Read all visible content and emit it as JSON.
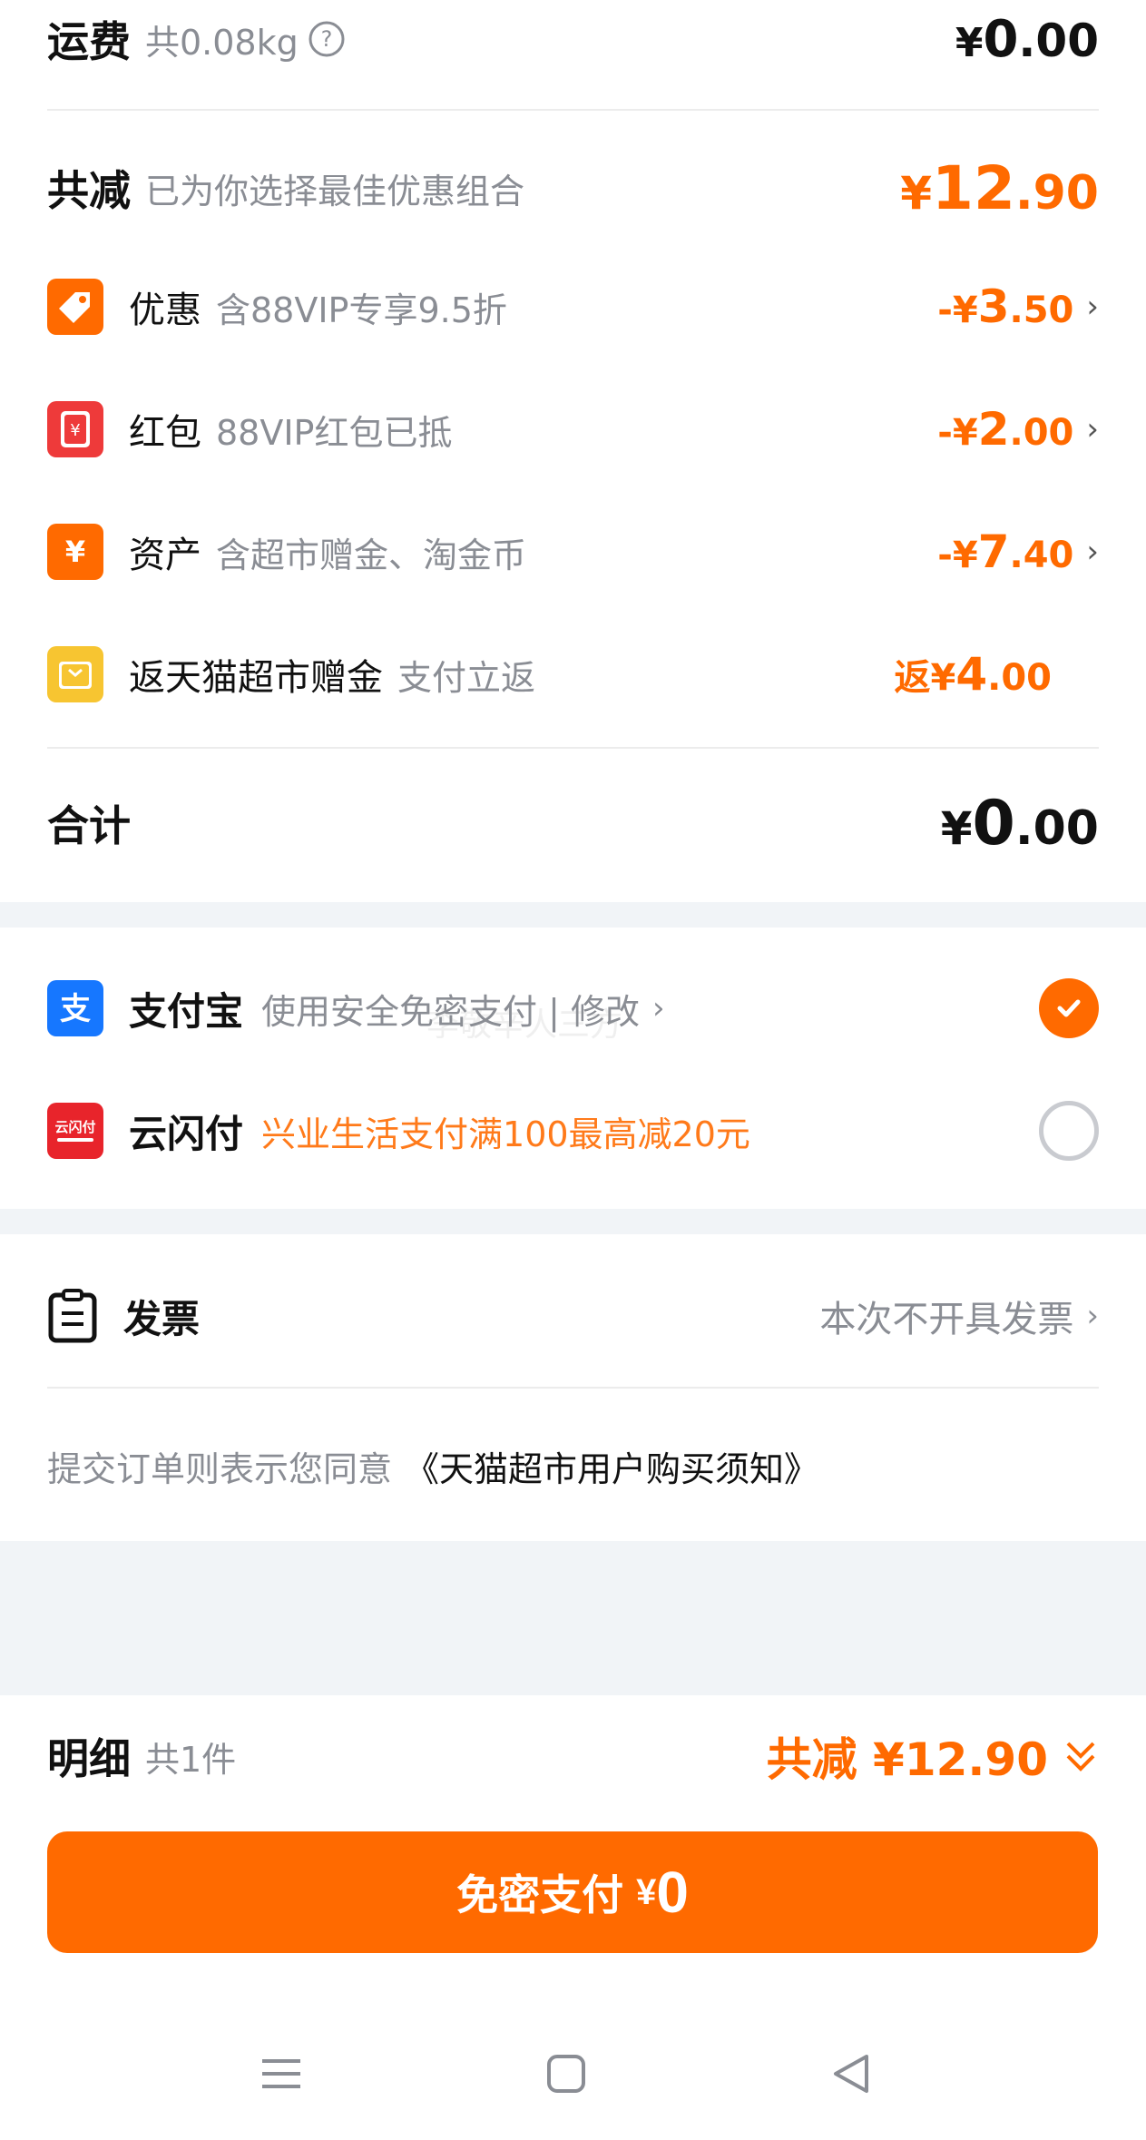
{
  "shipping": {
    "label": "运费",
    "weight": "共0.08kg",
    "help_icon": "question-circle-icon",
    "price_symbol": "¥",
    "price_int": "0",
    "price_dec": ".00"
  },
  "discount_total": {
    "label": "共减",
    "subtitle": "已为你选择最佳优惠组合",
    "price_symbol": "¥",
    "price_int": "12",
    "price_dec": ".90"
  },
  "discount_items": [
    {
      "icon": "tag-icon",
      "label": "优惠",
      "sub": "含88VIP专享9.5折",
      "prefix": "-¥",
      "int": "3",
      "dec": ".50",
      "color": "#ff6a00"
    },
    {
      "icon": "red-envelope-icon",
      "label": "红包",
      "sub": "88VIP红包已抵",
      "prefix": "-¥",
      "int": "2",
      "dec": ".00",
      "color": "#ee3a3a"
    },
    {
      "icon": "yuan-coin-icon",
      "label": "资产",
      "sub": "含超市赠金、淘金币",
      "prefix": "-¥",
      "int": "7",
      "dec": ".40",
      "color": "#ff6a00"
    },
    {
      "icon": "cash-back-icon",
      "label": "返天猫超市赠金",
      "sub": "支付立返",
      "prefix": "返¥",
      "int": "4",
      "dec": ".00",
      "color": "#f7c531"
    }
  ],
  "total": {
    "label": "合计",
    "price_symbol": "¥",
    "price_int": "0",
    "price_dec": ".00"
  },
  "payment_methods": [
    {
      "icon": "alipay-icon",
      "name": "支付宝",
      "desc": "使用安全免密支付 | 修改",
      "selected": true,
      "color": "#1677ff"
    },
    {
      "icon": "unionpay-icon",
      "name": "云闪付",
      "desc": "兴业生活支付满100最高减20元",
      "selected": false,
      "color": "#e8242b",
      "icon_text": "云闪付"
    }
  ],
  "invoice": {
    "label": "发票",
    "value": "本次不开具发票"
  },
  "agreement": {
    "prefix": "提交订单则表示您同意",
    "link": "《天猫超市用户购买须知》"
  },
  "detail_bar": {
    "label": "明细",
    "count": "共1件",
    "saving": "共减 ¥12.90"
  },
  "pay_button": {
    "label": "免密支付",
    "symbol": "¥",
    "amount": "0"
  },
  "watermark": "李敬辛人三方",
  "colors": {
    "accent": "#ff6a00",
    "background_gap": "#f1f4f7"
  }
}
